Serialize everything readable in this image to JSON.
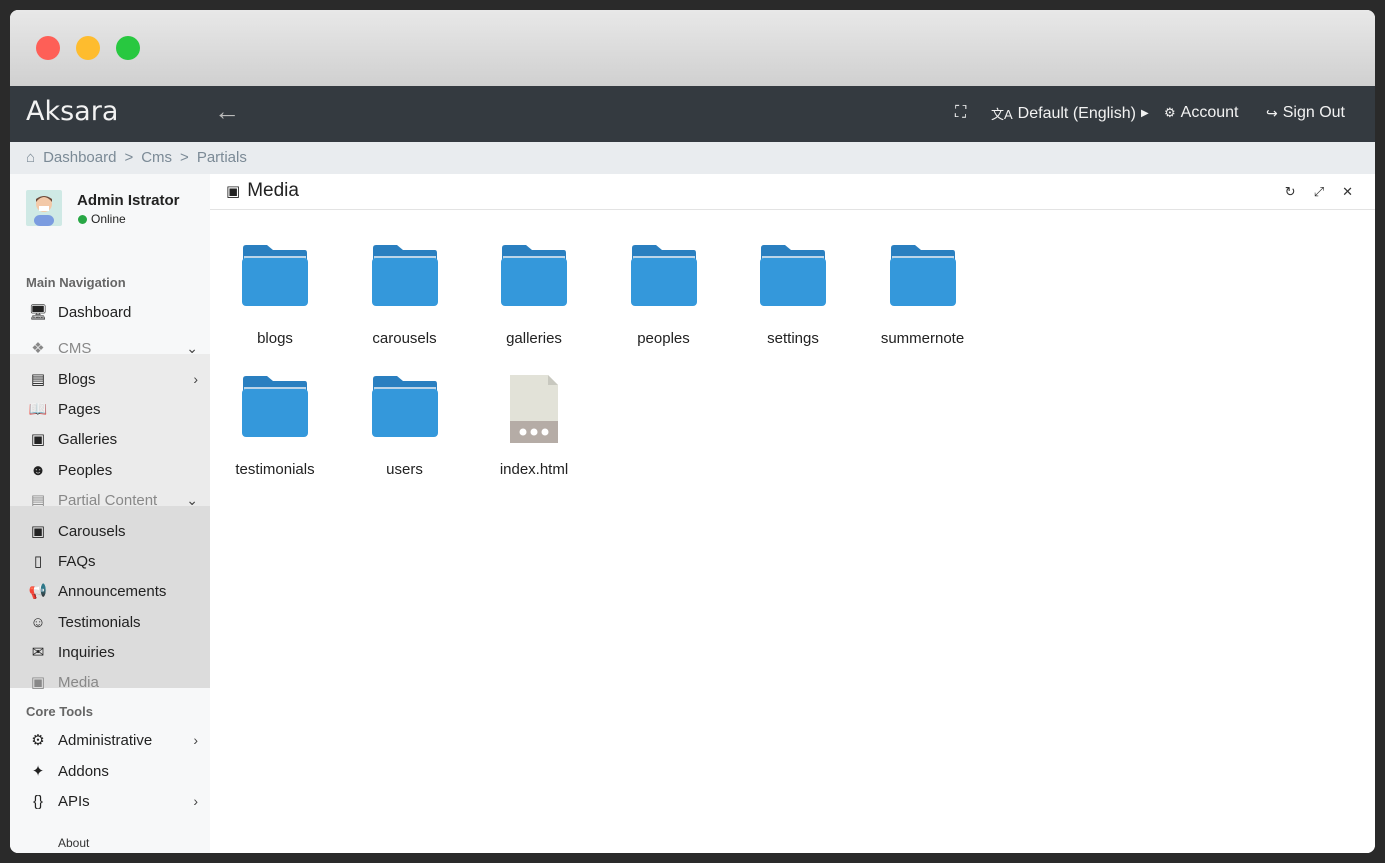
{
  "window": {
    "controls": [
      "close",
      "minimize",
      "maximize"
    ]
  },
  "navbar": {
    "brand": "Aksara",
    "language": "Default (English)",
    "account": "Account",
    "signout": "Sign Out"
  },
  "breadcrumb": [
    "Dashboard",
    "Cms",
    "Partials"
  ],
  "user": {
    "name": "Admin Istrator",
    "status": "Online",
    "status_color": "#28a745"
  },
  "sidebar": {
    "main_header": "Main Navigation",
    "dashboard": "Dashboard",
    "cms": "CMS",
    "blogs": "Blogs",
    "pages": "Pages",
    "galleries": "Galleries",
    "peoples": "Peoples",
    "partial": "Partial Content",
    "carousels": "Carousels",
    "faqs": "FAQs",
    "announcements": "Announcements",
    "testimonials": "Testimonials",
    "inquiries": "Inquiries",
    "media": "Media",
    "core_header": "Core Tools",
    "administrative": "Administrative",
    "addons": "Addons",
    "apis": "APIs",
    "about": "About"
  },
  "page": {
    "title": "Media"
  },
  "files": [
    {
      "name": "blogs",
      "type": "folder"
    },
    {
      "name": "carousels",
      "type": "folder"
    },
    {
      "name": "galleries",
      "type": "folder"
    },
    {
      "name": "peoples",
      "type": "folder"
    },
    {
      "name": "settings",
      "type": "folder"
    },
    {
      "name": "summernote",
      "type": "folder"
    },
    {
      "name": "testimonials",
      "type": "folder"
    },
    {
      "name": "users",
      "type": "folder"
    },
    {
      "name": "index.html",
      "type": "file"
    }
  ],
  "colors": {
    "navbar": "#343a40",
    "folder": "#3498db",
    "folder_tab": "#2a7fc0"
  }
}
